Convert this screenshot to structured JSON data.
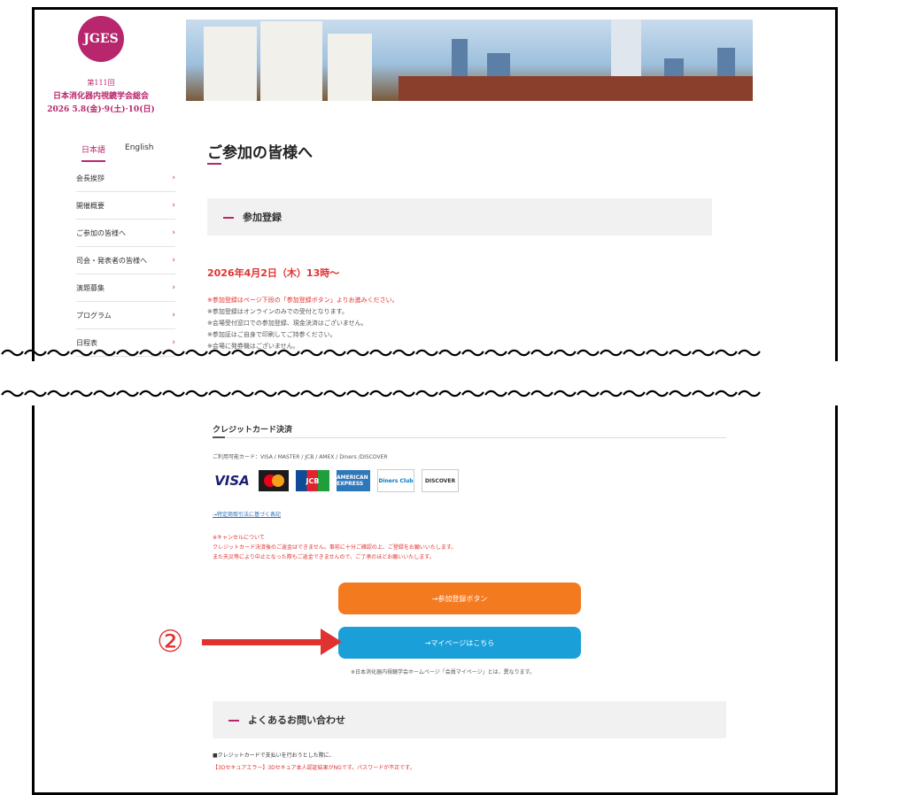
{
  "logo": {
    "mark": "JGES",
    "line1": "第111回",
    "line2": "日本消化器内視鏡学会総会",
    "line3": "2026 5.8(金)·9(土)·10(日)"
  },
  "lang": {
    "ja": "日本語",
    "en": "English"
  },
  "side_nav": [
    "会長挨拶",
    "開催概要",
    "ご参加の皆様へ",
    "司会・発表者の皆様へ",
    "演題募集",
    "プログラム",
    "日程表"
  ],
  "page_title": "ご参加の皆様へ",
  "section_registration": "参加登録",
  "reg_date": "2026年4月2日（木）13時～",
  "notes": {
    "red": "※参加登録はページ下段の「参加登録ボタン」よりお進みください。",
    "items": [
      "※参加登録はオンラインのみでの受付となります。",
      "※会場受付窓口での参加登録、現金決済はございません。",
      "※参加証はご自身で印刷してご持参ください。",
      "※会場に発券機はございません。"
    ]
  },
  "squiggle": "～～～～～～～～～～～～～～～～～～～～～～～～～～～～～～～～～",
  "credit": {
    "title": "クレジットカード決済",
    "available": "ご利用可能カード：VISA / MASTER / JCB / AMEX / Diners /DISCOVER",
    "cards": {
      "visa": "VISA",
      "jcb": "JCB",
      "amex": "AMERICAN EXPRESS",
      "diners": "Diners Club",
      "discover": "DISCOVER"
    },
    "tokutei_link": "→特定商取引法に基づく表記",
    "cancel_title": "※キャンセルについて",
    "cancel_1": "クレジットカード決済後のご返金はできません。事前に十分ご確認の上、ご登録をお願いいたします。",
    "cancel_2": "また天災等により中止となった際もご返金できませんので、ご了承のほどお願いいたします。"
  },
  "buttons": {
    "register": "→参加登録ボタン",
    "mypage": "→マイページはこちら"
  },
  "mypage_note": "※日本消化器内視鏡学会ホームページ「会員マイページ」とは、異なります。",
  "annotation": "②",
  "faq": {
    "title": "よくあるお問い合わせ",
    "note1": "■クレジットカードで支払いを行おうとした際に、",
    "note2": "【3Dセキュアエラー】3Dセキュア本人認証結果がNGです。パスワードが不正です。"
  }
}
